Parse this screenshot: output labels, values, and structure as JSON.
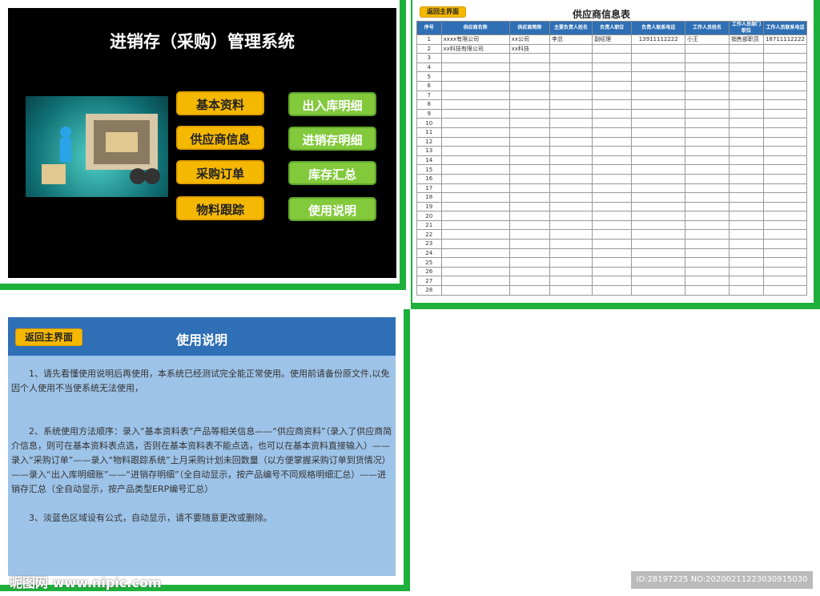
{
  "main_menu": {
    "title": "进销存（采购）管理系统",
    "buttons_left": [
      "基本资料",
      "供应商信息",
      "采购订单",
      "物料跟踪"
    ],
    "buttons_right": [
      "出入库明细",
      "进销存明细",
      "库存汇总",
      "使用说明"
    ]
  },
  "supplier": {
    "back_label": "返回主界面",
    "title": "供应商信息表",
    "headers": [
      "序号",
      "供应商名称",
      "供应商简称",
      "主要负责人姓名",
      "负责人职位",
      "负责人联系电话",
      "工作人员姓名",
      "工作人员部门职位",
      "工作人员联系电话"
    ],
    "rows": [
      [
        "1",
        "xxxx有限公司",
        "xx公司",
        "李总",
        "副经理",
        "13911112222",
        "小王",
        "销售部职员",
        "18711112222"
      ],
      [
        "2",
        "xx科技有限公司",
        "xx科技",
        "",
        "",
        "",
        "",
        "",
        ""
      ]
    ],
    "row_count": 28
  },
  "help": {
    "back_label": "返回主界面",
    "title": "使用说明",
    "paragraphs": [
      "1、请先看懂使用说明后再使用，本系统已经测试完全能正常使用。使用前请备份原文件,以免因个人使用不当使系统无法使用，",
      "2、系统使用方法顺序：录入“基本资料表”产品等相关信息——“供应商资料”（录入了供应商简介信息，则可在基本资料表点选，否则在基本资料表不能点选，也可以在基本资料直接输入）——录入“采购订单”——录入“物料跟踪系统”上月采购计划未回数量（以方便掌握采购订单到货情况）——录入“出入库明细账”——“进销存明细”（全自动显示，按产品编号不同规格明细汇总）——进销存汇总（全自动显示，按产品类型ERP编号汇总）",
      "3、淡蓝色区域设有公式，自动显示，请不要随意更改或删除。"
    ]
  },
  "watermark": {
    "site": "昵图网 www.nipic.com",
    "id": "ID:28197225 NO:20200211223030915030"
  }
}
